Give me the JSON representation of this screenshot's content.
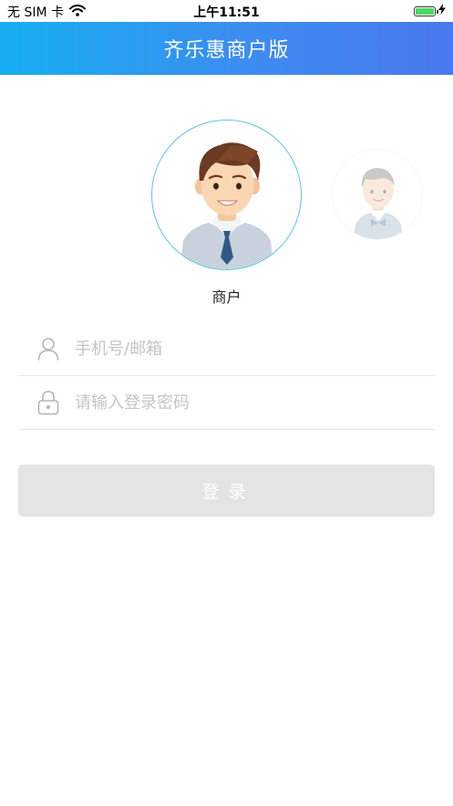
{
  "status_bar": {
    "carrier": "无 SIM 卡",
    "time": "上午11:51",
    "battery_level": 1.0
  },
  "nav": {
    "title": "齐乐惠商户版"
  },
  "role_selector": {
    "selected_label": "商户"
  },
  "form": {
    "account_placeholder": "手机号/邮箱",
    "password_placeholder": "请输入登录密码",
    "account_icon": "user-icon",
    "password_icon": "lock-icon"
  },
  "login_button": {
    "label": "登录"
  },
  "colors": {
    "nav_gradient_start": "#16aef0",
    "nav_gradient_end": "#4a78ee",
    "avatar_border": "#5ac8e0",
    "button_disabled": "#e4e4e4",
    "placeholder": "#c4c4c4"
  }
}
